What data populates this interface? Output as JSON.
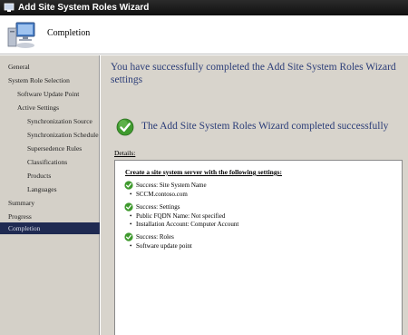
{
  "window": {
    "title": "Add Site System Roles Wizard",
    "page_title": "Completion"
  },
  "sidebar": {
    "items": [
      {
        "label": "General"
      },
      {
        "label": "System Role Selection"
      },
      {
        "label": "Software Update Point"
      },
      {
        "label": "Active Settings"
      },
      {
        "label": "Synchronization Source"
      },
      {
        "label": "Synchronization Schedule"
      },
      {
        "label": "Supersedence Rules"
      },
      {
        "label": "Classifications"
      },
      {
        "label": "Products"
      },
      {
        "label": "Languages"
      },
      {
        "label": "Summary"
      },
      {
        "label": "Progress"
      },
      {
        "label": "Completion"
      }
    ],
    "active_index": 12
  },
  "main": {
    "heading": "You have successfully completed the Add Site System Roles Wizard settings",
    "success_message": "The Add Site System Roles Wizard completed successfully",
    "details_label": "Details:",
    "details_title": "Create a site system server with the following settings:",
    "groups": [
      {
        "status": "Success: Site System Name",
        "items": [
          "SCCM.contoso.com"
        ]
      },
      {
        "status": "Success: Settings",
        "items": [
          "Public FQDN Name: Not specified",
          "Installation Account: Computer Account"
        ]
      },
      {
        "status": "Success: Roles",
        "items": [
          "Software update point"
        ]
      }
    ]
  },
  "colors": {
    "heading": "#2b3d78",
    "sidebar_bg": "#d4d0c8",
    "active_item_bg": "#1f2a52",
    "success_green": "#3f9a2e"
  }
}
